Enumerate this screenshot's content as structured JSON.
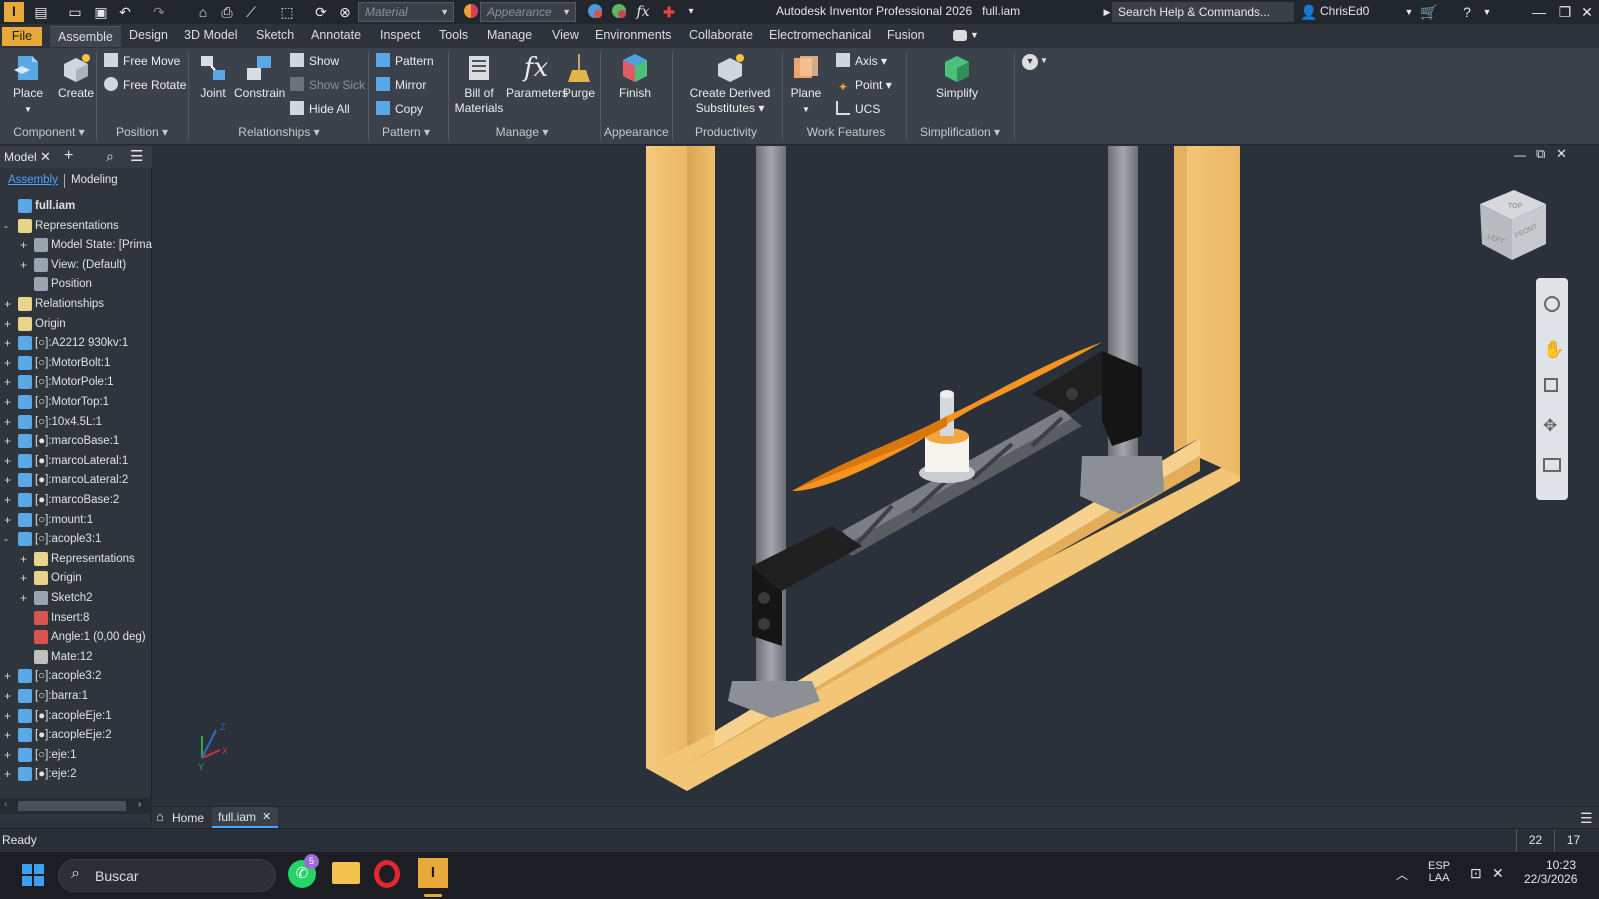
{
  "titlebar": {
    "material_placeholder": "Material",
    "appearance_placeholder": "Appearance",
    "app_title": "Autodesk Inventor Professional 2026",
    "doc_name": "full.iam",
    "search_help": "Search Help & Commands...",
    "user": "ChrisEd0"
  },
  "tabs": [
    "File",
    "Assemble",
    "Design",
    "3D Model",
    "Sketch",
    "Annotate",
    "Inspect",
    "Tools",
    "Manage",
    "View",
    "Environments",
    "Collaborate",
    "Electromechanical",
    "Fusion"
  ],
  "ribbon": {
    "place": "Place",
    "create": "Create",
    "free_move": "Free Move",
    "free_rotate": "Free Rotate",
    "joint": "Joint",
    "constrain": "Constrain",
    "show": "Show",
    "show_sick": "Show Sick",
    "hide_all": "Hide All",
    "pattern": "Pattern",
    "mirror": "Mirror",
    "copy": "Copy",
    "bom_line1": "Bill of",
    "bom_line2": "Materials",
    "parameters": "Parameters",
    "purge": "Purge",
    "finish": "Finish",
    "derived_line1": "Create Derived",
    "derived_line2": "Substitutes",
    "plane": "Plane",
    "axis": "Axis",
    "point": "Point",
    "ucs": "UCS",
    "simplify": "Simplify",
    "groups": {
      "component": "Component",
      "position": "Position",
      "relationships": "Relationships",
      "pattern": "Pattern",
      "manage": "Manage",
      "appearance": "Appearance",
      "productivity": "Productivity",
      "work_features": "Work Features",
      "simplification": "Simplification"
    }
  },
  "browser": {
    "tab_model": "Model",
    "view_assembly": "Assembly",
    "view_modeling": "Modeling",
    "items": [
      {
        "label": "full.iam",
        "level": 0,
        "exp": "",
        "icon": "assembly"
      },
      {
        "label": "Representations",
        "level": 0,
        "exp": "-",
        "icon": "folder"
      },
      {
        "label": "Model State: [Primar",
        "level": 1,
        "exp": "+",
        "icon": "state"
      },
      {
        "label": "View: (Default)",
        "level": 1,
        "exp": "+",
        "icon": "view"
      },
      {
        "label": "Position",
        "level": 1,
        "exp": "",
        "icon": "position"
      },
      {
        "label": "Relationships",
        "level": 0,
        "exp": "+",
        "icon": "folder"
      },
      {
        "label": "Origin",
        "level": 0,
        "exp": "+",
        "icon": "folder"
      },
      {
        "label": "[○]:A2212 930kv:1",
        "level": 0,
        "exp": "+",
        "icon": "assembly"
      },
      {
        "label": "[○]:MotorBolt:1",
        "level": 0,
        "exp": "+",
        "icon": "assembly"
      },
      {
        "label": "[○]:MotorPole:1",
        "level": 0,
        "exp": "+",
        "icon": "part"
      },
      {
        "label": "[○]:MotorTop:1",
        "level": 0,
        "exp": "+",
        "icon": "part"
      },
      {
        "label": "[○]:10x4.5L:1",
        "level": 0,
        "exp": "+",
        "icon": "part"
      },
      {
        "label": "[●]:marcoBase:1",
        "level": 0,
        "exp": "+",
        "icon": "part"
      },
      {
        "label": "[●]:marcoLateral:1",
        "level": 0,
        "exp": "+",
        "icon": "part"
      },
      {
        "label": "[●]:marcoLateral:2",
        "level": 0,
        "exp": "+",
        "icon": "part"
      },
      {
        "label": "[●]:marcoBase:2",
        "level": 0,
        "exp": "+",
        "icon": "part"
      },
      {
        "label": "[○]:mount:1",
        "level": 0,
        "exp": "+",
        "icon": "part"
      },
      {
        "label": "[○]:acople3:1",
        "level": 0,
        "exp": "-",
        "icon": "part"
      },
      {
        "label": "Representations",
        "level": 1,
        "exp": "+",
        "icon": "folder"
      },
      {
        "label": "Origin",
        "level": 1,
        "exp": "+",
        "icon": "folder"
      },
      {
        "label": "Sketch2",
        "level": 1,
        "exp": "+",
        "icon": "sketch"
      },
      {
        "label": "Insert:8",
        "level": 1,
        "exp": "",
        "icon": "insert"
      },
      {
        "label": "Angle:1 (0,00 deg)",
        "level": 1,
        "exp": "",
        "icon": "angle"
      },
      {
        "label": "Mate:12",
        "level": 1,
        "exp": "",
        "icon": "mate"
      },
      {
        "label": "[○]:acople3:2",
        "level": 0,
        "exp": "+",
        "icon": "part"
      },
      {
        "label": "[○]:barra:1",
        "level": 0,
        "exp": "+",
        "icon": "part"
      },
      {
        "label": "[●]:acopleEje:1",
        "level": 0,
        "exp": "+",
        "icon": "part"
      },
      {
        "label": "[●]:acopleEje:2",
        "level": 0,
        "exp": "+",
        "icon": "part"
      },
      {
        "label": "[○]:eje:1",
        "level": 0,
        "exp": "+",
        "icon": "part"
      },
      {
        "label": "[●]:eje:2",
        "level": 0,
        "exp": "+",
        "icon": "part"
      }
    ]
  },
  "viewcube": {
    "top": "TOP",
    "left": "LEFT",
    "front": "FRONT"
  },
  "triad": {
    "x": "X",
    "y": "Y",
    "z": "Z"
  },
  "doc_tabs": {
    "home": "Home",
    "file": "full.iam"
  },
  "status": {
    "text": "Ready",
    "num1": "22",
    "num2": "17"
  },
  "taskbar": {
    "search": "Buscar",
    "whatsapp_badge": "5",
    "lang1": "ESP",
    "lang2": "LAA",
    "time": "10:23",
    "date": "22/3/2026"
  },
  "colors": {
    "file_tab": "#e8a93a",
    "wood": "#f2c272",
    "propeller": "#f7941d",
    "bracket": "#1b1b1b",
    "link": "#4aa3ff"
  }
}
